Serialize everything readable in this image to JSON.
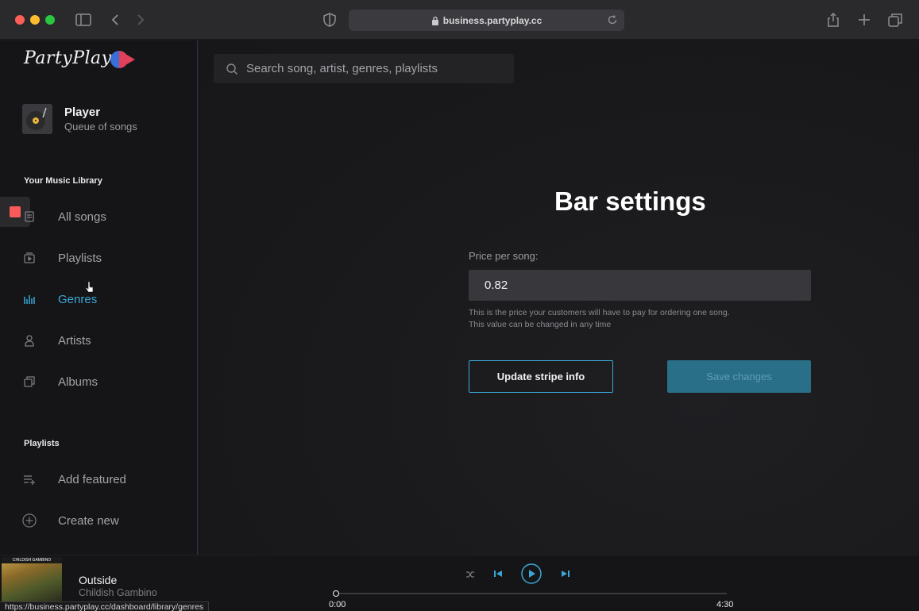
{
  "browser": {
    "url": "business.partyplay.cc"
  },
  "sidebar": {
    "logo": "PartyPlay",
    "player": {
      "title": "Player",
      "subtitle": "Queue of songs"
    },
    "library_heading": "Your Music Library",
    "library_items": [
      {
        "label": "All songs",
        "icon": "music-notes-icon"
      },
      {
        "label": "Playlists",
        "icon": "playlist-icon"
      },
      {
        "label": "Genres",
        "icon": "equalizer-bars-icon",
        "active": true
      },
      {
        "label": "Artists",
        "icon": "person-icon"
      },
      {
        "label": "Albums",
        "icon": "album-stack-icon"
      }
    ],
    "playlists_heading": "Playlists",
    "playlist_items": [
      {
        "label": "Add featured",
        "icon": "add-list-icon"
      },
      {
        "label": "Create new",
        "icon": "plus-circle-icon"
      }
    ]
  },
  "search": {
    "placeholder": "Search song, artist, genres, playlists"
  },
  "settings": {
    "title": "Bar settings",
    "price_label": "Price per song:",
    "price_value": "0.82",
    "hint_line1": "This is the price your customers will have to pay for ordering one song.",
    "hint_line2": "This value can be changed in any time",
    "update_button": "Update stripe info",
    "save_button": "Save changes"
  },
  "now_playing": {
    "album_label": "CHILDISH GAMBINO",
    "title": "Outside",
    "artist": "Childish Gambino",
    "elapsed": "0:00",
    "duration": "4:30",
    "progress": 0
  },
  "status_url": "https://business.partyplay.cc/dashboard/library/genres",
  "colors": {
    "accent": "#3aa6d6",
    "stop": "#fa5a5a",
    "save_button_bg": "#2a6f88"
  }
}
